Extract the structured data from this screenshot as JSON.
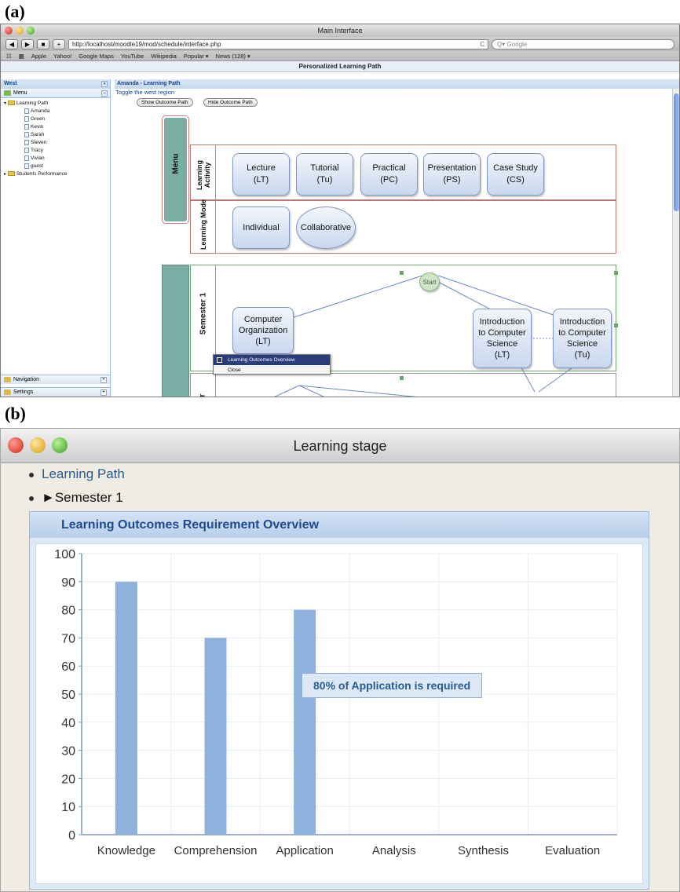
{
  "labels": {
    "a": "(a)",
    "b": "(b)"
  },
  "browser": {
    "window_title": "Main Interface",
    "url": "http://localhost/moodle19/mod/schedule/interface.php",
    "reload_icon": "C",
    "search_placeholder": "Q▾ Google",
    "nav_back": "◀",
    "nav_forward": "▶",
    "add_bookmark": "+",
    "bookmarks": [
      "Apple",
      "Yahoo!",
      "Google Maps",
      "YouTube",
      "Wikipedia",
      "Popular ▾",
      "News (128) ▾"
    ],
    "page_title": "Personalized Learning Path"
  },
  "west": {
    "title": "West",
    "collapse": "«",
    "menu_label": "Menu",
    "menu_toggle": "–",
    "tree": {
      "root": "Learning Path",
      "students": [
        "Amanda",
        "Green",
        "Kevin",
        "Sarah",
        "Steven",
        "Tracy",
        "Vivian",
        "guest"
      ],
      "second_root": "Students Performance"
    },
    "footer": [
      {
        "label": "Navigation",
        "action": "+"
      },
      {
        "label": "Settings",
        "action": "+"
      }
    ]
  },
  "center": {
    "title": "Amanda - Learning Path",
    "toggle_link": "Toggle the west region",
    "buttons": {
      "show": "Show Outcome Path",
      "hide": "Hide Outcome Path"
    },
    "menu_label": "Menu",
    "activity_label": "Learning Activity",
    "mode_label": "Learning Mode",
    "activities": [
      {
        "line1": "Lecture",
        "line2": "(LT)"
      },
      {
        "line1": "Tutorial",
        "line2": "(Tu)"
      },
      {
        "line1": "Practical",
        "line2": "(PC)"
      },
      {
        "line1": "Presentation",
        "line2": "(PS)"
      },
      {
        "line1": "Case Study",
        "line2": "(CS)"
      }
    ],
    "modes": [
      "Individual",
      "Collaborative"
    ],
    "semester_label": "Semester 1",
    "semester2_label": "er",
    "start": "Start",
    "nodes": [
      {
        "lines": [
          "Computer",
          "Organization",
          "(LT)"
        ]
      },
      {
        "lines": [
          "Introduction",
          "to Computer",
          "Science",
          "(LT)"
        ]
      },
      {
        "lines": [
          "Introduction",
          "to Computer",
          "Science",
          "(Tu)"
        ]
      }
    ],
    "context_menu": [
      "Learning Outcomes Overview",
      "Close"
    ]
  },
  "stage": {
    "window_title": "Learning stage",
    "bullets": [
      "Learning Path",
      "►Semester 1"
    ],
    "panel_title": "Learning Outcomes Requirement Overview",
    "tooltip": "80% of Application is required"
  },
  "chart_data": {
    "type": "bar",
    "categories": [
      "Knowledge",
      "Comprehension",
      "Application",
      "Analysis",
      "Synthesis",
      "Evaluation"
    ],
    "values": [
      90,
      70,
      80,
      0,
      0,
      0
    ],
    "ylim": [
      0,
      100
    ],
    "yticks": [
      0,
      10,
      20,
      30,
      40,
      50,
      60,
      70,
      80,
      90,
      100
    ],
    "grid": true,
    "bar_color": "#8fb1dd"
  }
}
